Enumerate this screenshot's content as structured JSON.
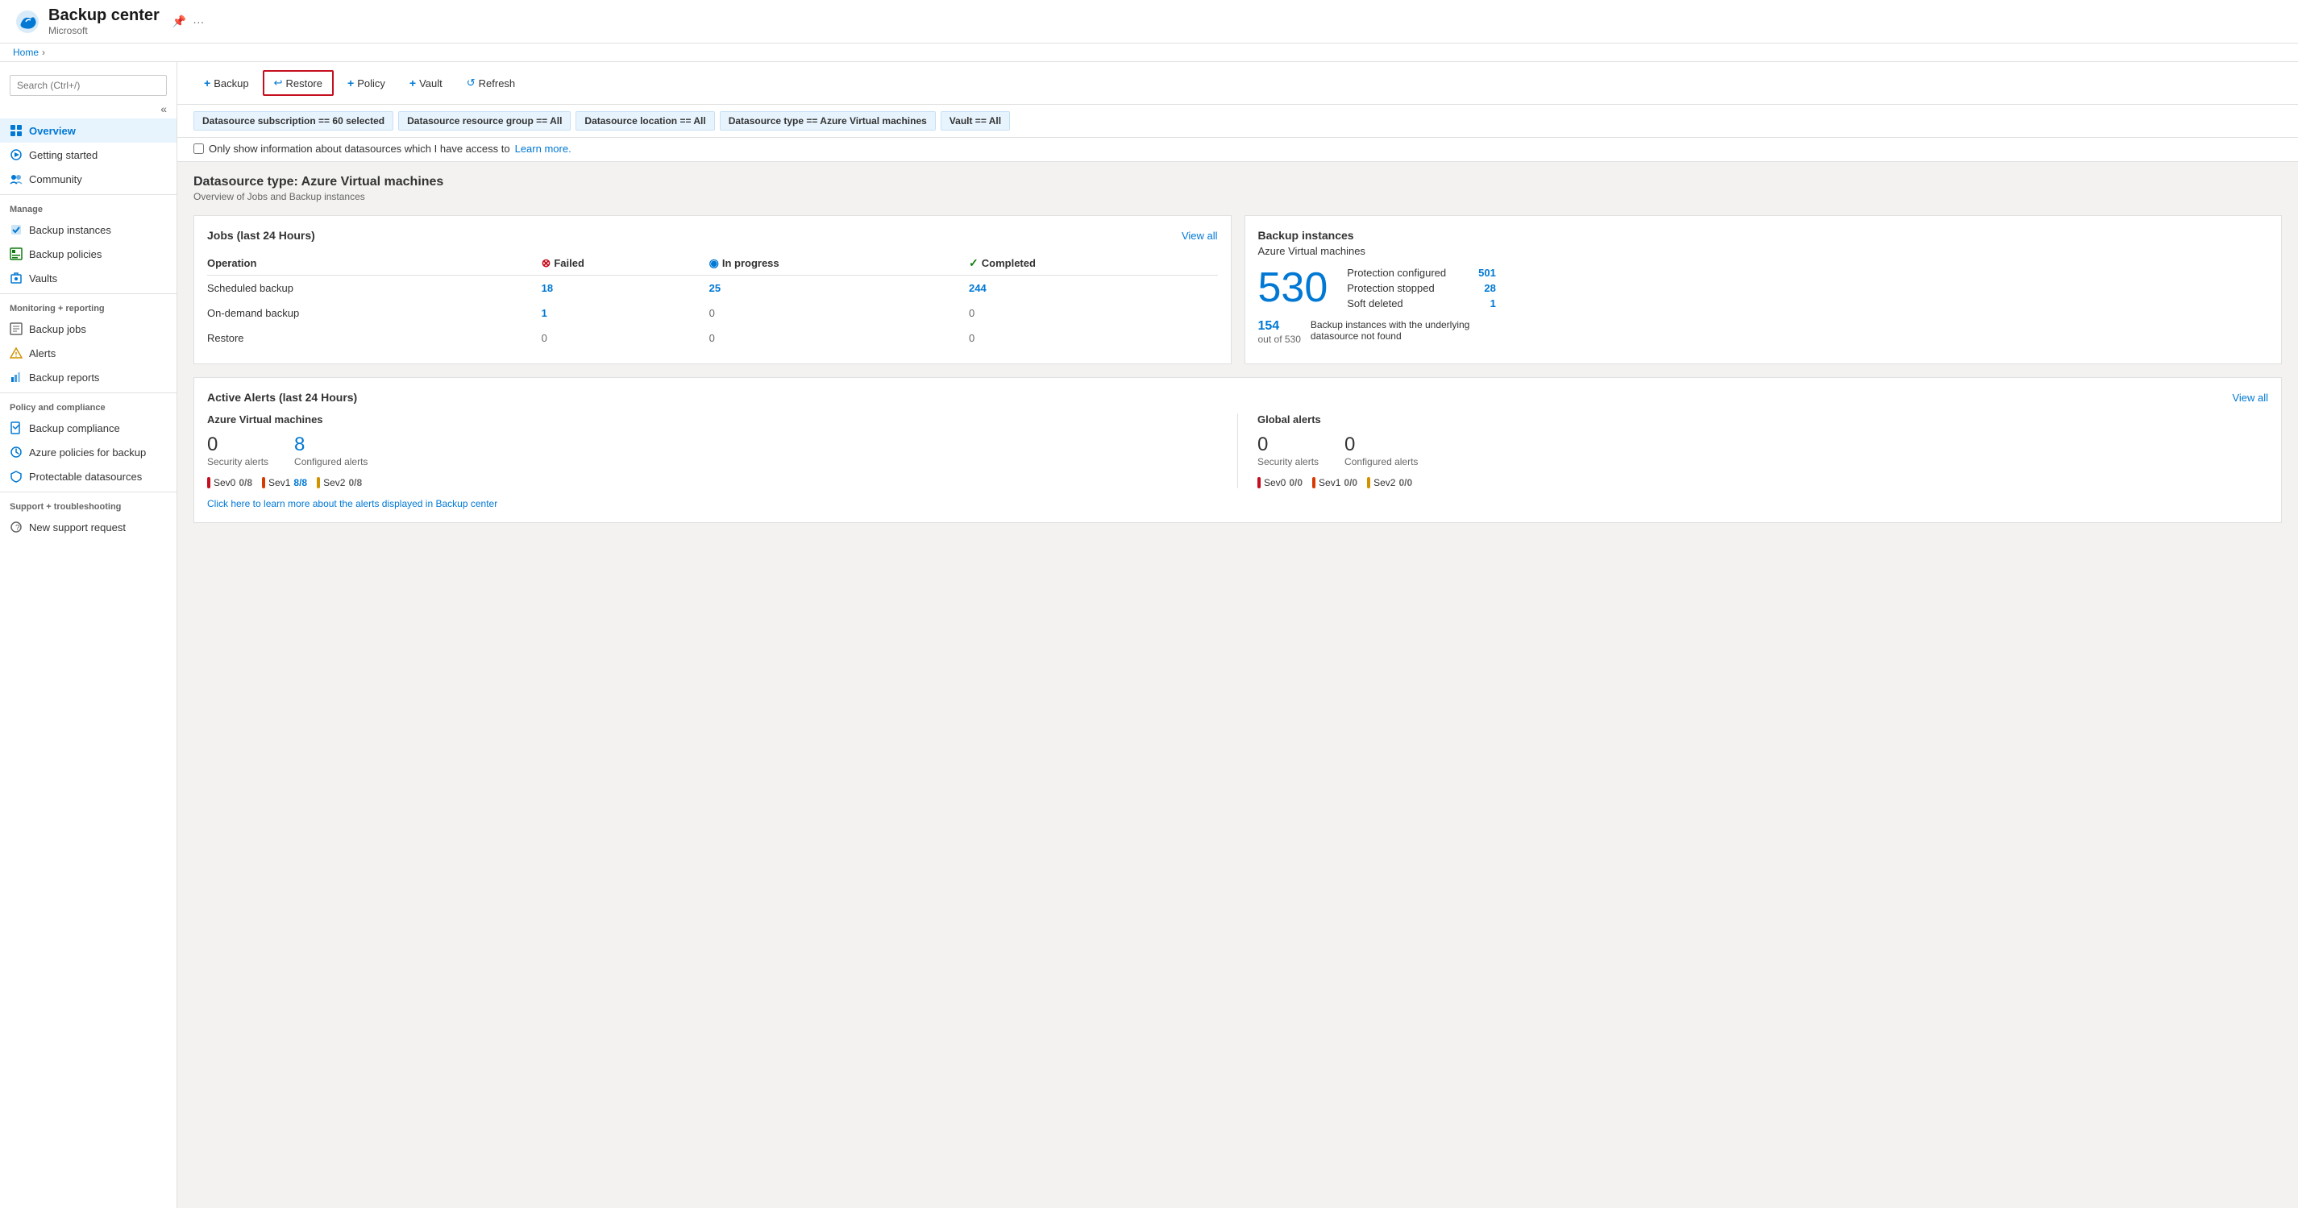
{
  "app": {
    "title": "Backup center",
    "subtitle": "Microsoft",
    "breadcrumb": [
      "Home"
    ]
  },
  "sidebar": {
    "search_placeholder": "Search (Ctrl+/)",
    "collapse_label": "«",
    "nav_items": [
      {
        "id": "overview",
        "label": "Overview",
        "active": true,
        "icon": "overview-icon"
      },
      {
        "id": "getting-started",
        "label": "Getting started",
        "active": false,
        "icon": "getting-started-icon"
      },
      {
        "id": "community",
        "label": "Community",
        "active": false,
        "icon": "community-icon"
      }
    ],
    "manage_section": "Manage",
    "manage_items": [
      {
        "id": "backup-instances",
        "label": "Backup instances",
        "icon": "backup-instances-icon"
      },
      {
        "id": "backup-policies",
        "label": "Backup policies",
        "icon": "backup-policies-icon"
      },
      {
        "id": "vaults",
        "label": "Vaults",
        "icon": "vaults-icon"
      }
    ],
    "monitoring_section": "Monitoring + reporting",
    "monitoring_items": [
      {
        "id": "backup-jobs",
        "label": "Backup jobs",
        "icon": "backup-jobs-icon"
      },
      {
        "id": "alerts",
        "label": "Alerts",
        "icon": "alerts-icon"
      },
      {
        "id": "backup-reports",
        "label": "Backup reports",
        "icon": "backup-reports-icon"
      }
    ],
    "policy_section": "Policy and compliance",
    "policy_items": [
      {
        "id": "backup-compliance",
        "label": "Backup compliance",
        "icon": "backup-compliance-icon"
      },
      {
        "id": "azure-policies",
        "label": "Azure policies for backup",
        "icon": "azure-policies-icon"
      },
      {
        "id": "protectable-datasources",
        "label": "Protectable datasources",
        "icon": "protectable-datasources-icon"
      }
    ],
    "support_section": "Support + troubleshooting",
    "support_items": [
      {
        "id": "new-support-request",
        "label": "New support request",
        "icon": "support-icon"
      }
    ]
  },
  "toolbar": {
    "backup_label": "Backup",
    "restore_label": "Restore",
    "policy_label": "Policy",
    "vault_label": "Vault",
    "refresh_label": "Refresh"
  },
  "filters": [
    {
      "id": "subscription",
      "text": "Datasource subscription == ",
      "value": "60 selected"
    },
    {
      "id": "resource-group",
      "text": "Datasource resource group == ",
      "value": "All"
    },
    {
      "id": "location",
      "text": "Datasource location == ",
      "value": "All"
    },
    {
      "id": "type",
      "text": "Datasource type == ",
      "value": "Azure Virtual machines"
    },
    {
      "id": "vault",
      "text": "Vault == ",
      "value": "All"
    }
  ],
  "checkbox": {
    "label": "Only show information about datasources which I have access to",
    "link_label": "Learn more."
  },
  "datasource": {
    "title": "Datasource type: Azure Virtual machines",
    "subtitle": "Overview of Jobs and Backup instances"
  },
  "jobs_card": {
    "title": "Jobs (last 24 Hours)",
    "view_all": "View all",
    "columns": [
      "Operation",
      "Failed",
      "In progress",
      "Completed"
    ],
    "rows": [
      {
        "operation": "Scheduled backup",
        "failed": "18",
        "in_progress": "25",
        "completed": "244",
        "failed_is_num": true,
        "progress_is_num": true,
        "completed_is_num": true
      },
      {
        "operation": "On-demand backup",
        "failed": "1",
        "in_progress": "0",
        "completed": "0",
        "failed_is_num": true,
        "progress_is_num": false,
        "completed_is_num": false
      },
      {
        "operation": "Restore",
        "failed": "0",
        "in_progress": "0",
        "completed": "0",
        "failed_is_num": false,
        "progress_is_num": false,
        "completed_is_num": false
      }
    ]
  },
  "backup_instances_card": {
    "title": "Backup instances",
    "subtitle": "Azure Virtual machines",
    "count": "530",
    "stats": [
      {
        "label": "Protection configured",
        "value": "501"
      },
      {
        "label": "Protection stopped",
        "value": "28"
      },
      {
        "label": "Soft deleted",
        "value": "1"
      }
    ],
    "footnote_count": "154",
    "footnote_out_of": "out of 530",
    "footnote_desc": "Backup instances with the underlying datasource not found"
  },
  "alerts_card": {
    "title": "Active Alerts (last 24 Hours)",
    "view_all": "View all",
    "vm_section": {
      "title": "Azure Virtual machines",
      "security_count": "0",
      "security_label": "Security alerts",
      "configured_count": "8",
      "configured_label": "Configured alerts",
      "sev_pills": [
        {
          "level": "Sev0",
          "value": "0/8",
          "dot_class": "red",
          "is_blue": false
        },
        {
          "level": "Sev1",
          "value": "8/8",
          "dot_class": "orange",
          "is_blue": true
        },
        {
          "level": "Sev2",
          "value": "0/8",
          "dot_class": "yellow",
          "is_blue": false
        }
      ]
    },
    "global_section": {
      "title": "Global alerts",
      "security_count": "0",
      "security_label": "Security alerts",
      "configured_count": "0",
      "configured_label": "Configured alerts",
      "sev_pills": [
        {
          "level": "Sev0",
          "value": "0/0",
          "dot_class": "red",
          "is_blue": false
        },
        {
          "level": "Sev1",
          "value": "0/0",
          "dot_class": "orange",
          "is_blue": false
        },
        {
          "level": "Sev2",
          "value": "0/0",
          "dot_class": "yellow",
          "is_blue": false
        }
      ]
    },
    "learn_more_link": "Click here to learn more about the alerts displayed in Backup center"
  },
  "colors": {
    "accent": "#0078d4",
    "danger": "#c50f1f",
    "success": "#107c10",
    "warning": "#d29200"
  }
}
